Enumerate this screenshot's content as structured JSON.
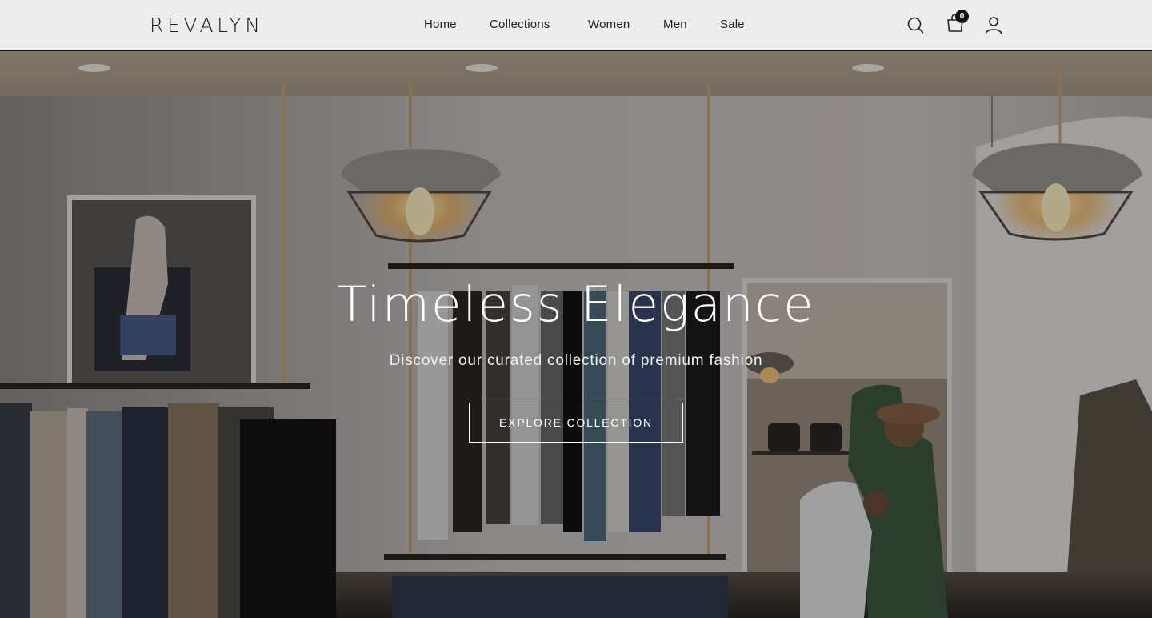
{
  "header": {
    "logo": "REVALYN",
    "nav": [
      {
        "label": "Home"
      },
      {
        "label": "Collections"
      },
      {
        "label": "Women"
      },
      {
        "label": "Men"
      },
      {
        "label": "Sale"
      }
    ],
    "icons": {
      "search": "search-icon",
      "cart": "shopping-bag-icon",
      "account": "user-icon"
    },
    "cart_count": "0"
  },
  "hero": {
    "title": "Timeless Elegance",
    "subtitle": "Discover our curated collection of premium fashion",
    "cta_label": "EXPLORE COLLECTION",
    "background": "clothing-boutique-interior-photo"
  },
  "colors": {
    "header_bg": "#ededed",
    "text_dark": "#1d1d1d",
    "hero_text": "#ffffff",
    "badge_bg": "#111111"
  }
}
